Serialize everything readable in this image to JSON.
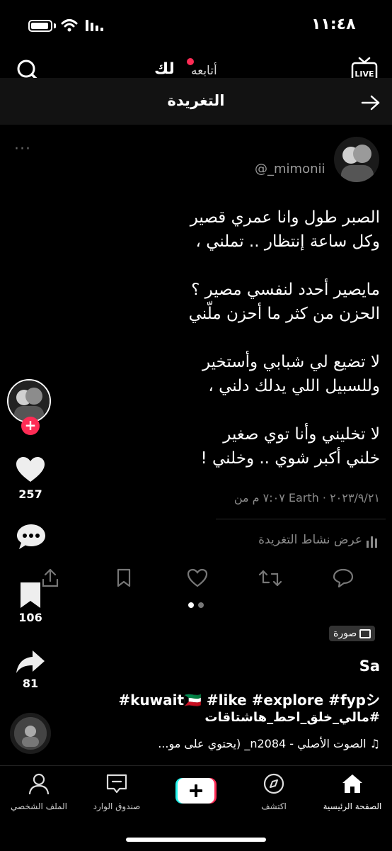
{
  "status_bar": {
    "time": "١١:٤٨"
  },
  "top_nav": {
    "tab_for_you": "لك",
    "tab_following": "أتابعه"
  },
  "header": {
    "title": "التغريدة"
  },
  "tweet": {
    "more": "···",
    "username": "@_mimonii",
    "text": "الصبر طول وانا عمري قصير\nوكل ساعة إنتظار .. تملني ،\n\nمايصير أحدد لنفسي مصير ؟\nالحزن من كثر ما أحزن ملّني\n\nلا تضيع لي شبابي وأستخير\nوللسبيل اللي يدلك دلني ،\n\nلا تخليني وأنا توي صغير\nخلني أكبر شوي .. وخلني !",
    "meta": "٧:٠٧ م من Earth · ٢٠٢٣/٩/٢١",
    "activity": "عرض نشاط التغريدة"
  },
  "side_actions": {
    "likes": "257",
    "saves": "106",
    "shares": "81"
  },
  "post": {
    "photo_label": "صورة",
    "author": "Sa",
    "tags_line1": "#kuwait🇰🇼 #like #explore #fypシ",
    "tags_line2": "#مالي_خلق_احط_هاشتاقات",
    "music": "♫ الصوت الأصلي - n2084_ (يحتوي على مو..."
  },
  "tabbar": {
    "home": "الصفحة الرئيسية",
    "discover": "اكتشف",
    "inbox": "صندوق الوارد",
    "profile": "الملف الشخصي"
  }
}
